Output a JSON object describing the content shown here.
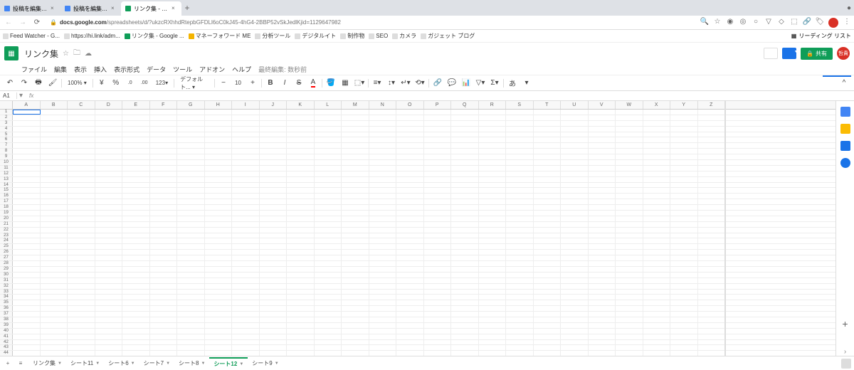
{
  "browser": {
    "tabs": [
      {
        "label": "投稿を編集・デジタル — WordP..."
      },
      {
        "label": "投稿を編集・デジタル — WordP..."
      },
      {
        "label": "リンク集 - Google スプレッド..."
      }
    ],
    "url_host": "docs.google.com",
    "url_path": "/spreadsheets/d/?ukzcRXhhdRtepbGFDLl6oC0kJ45-4hG4-2BBP52vSkJedlKjid=1129647982",
    "reading_list": "リーディング リスト"
  },
  "bookmarks": [
    "Feed Watcher - G...",
    "https://hi.link/adm...",
    "リンク集 - Google ...",
    "マネーフォワード ME",
    "分析ツール",
    "デジタルイト",
    "制作物",
    "SEO",
    "カメラ",
    "ガジェット ブログ"
  ],
  "doc": {
    "title": "リンク集",
    "share": "共有",
    "avatar": "哲貴",
    "menus": [
      "ファイル",
      "編集",
      "表示",
      "挿入",
      "表示形式",
      "データ",
      "ツール",
      "アドオン",
      "ヘルプ"
    ],
    "last_edit": "最終編集: 数秒前"
  },
  "toolbar": {
    "zoom": "100%",
    "currency": "¥",
    "percent": "%",
    "dec_dec": ".0",
    "dec_inc": ".00",
    "num_fmt": "123",
    "font": "デフォルト...",
    "size": "10"
  },
  "cell_ref": "A1",
  "columns": [
    "A",
    "B",
    "C",
    "D",
    "E",
    "F",
    "G",
    "H",
    "I",
    "J",
    "K",
    "L",
    "M",
    "N",
    "O",
    "P",
    "Q",
    "R",
    "S",
    "T",
    "U",
    "V",
    "W",
    "X",
    "Y",
    "Z"
  ],
  "row_count": 44,
  "sheet_tabs": [
    "リンク集",
    "シート11",
    "シート6",
    "シート7",
    "シート8",
    "シート12",
    "シート9"
  ],
  "active_sheet": 5
}
